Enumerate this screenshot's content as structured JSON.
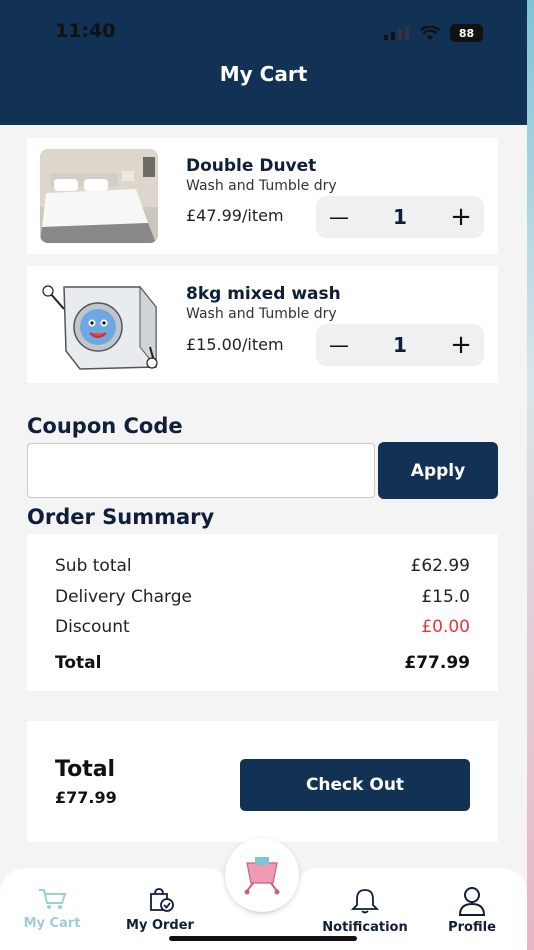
{
  "status_bar": {
    "time": "11:40",
    "battery": "88"
  },
  "header": {
    "title": "My Cart"
  },
  "cart": {
    "items": [
      {
        "name": "Double Duvet",
        "service": "Wash and Tumble dry",
        "price": "£47.99/item",
        "quantity": "1",
        "image_icon": "bedroom-photo"
      },
      {
        "name": "8kg mixed wash",
        "service": "Wash and Tumble dry",
        "price": "£15.00/item",
        "quantity": "1",
        "image_icon": "washing-machine-mascot"
      }
    ],
    "minus_symbol": "—",
    "plus_symbol": "+"
  },
  "coupon": {
    "title": "Coupon Code",
    "value": "",
    "apply_label": "Apply"
  },
  "summary": {
    "title": "Order Summary",
    "rows": [
      {
        "label": "Sub total",
        "value": "£62.99"
      },
      {
        "label": "Delivery Charge",
        "value": "£15.0"
      },
      {
        "label": "Discount",
        "value": "£0.00"
      },
      {
        "label": "Total",
        "value": "£77.99"
      }
    ]
  },
  "checkout": {
    "total_label": "Total",
    "total_value": "£77.99",
    "button_label": "Check Out"
  },
  "nav": {
    "items": [
      {
        "label": "My Cart",
        "icon": "cart-icon",
        "active": true
      },
      {
        "label": "My Order",
        "icon": "order-bag-icon",
        "active": false
      },
      {
        "label": "Notification",
        "icon": "bell-icon",
        "active": false
      },
      {
        "label": "Profile",
        "icon": "user-icon",
        "active": false
      }
    ]
  },
  "colors": {
    "primary": "#113155",
    "discount": "#e0393c",
    "active_nav": "#9ecfd8",
    "background": "#f4f4f5"
  }
}
